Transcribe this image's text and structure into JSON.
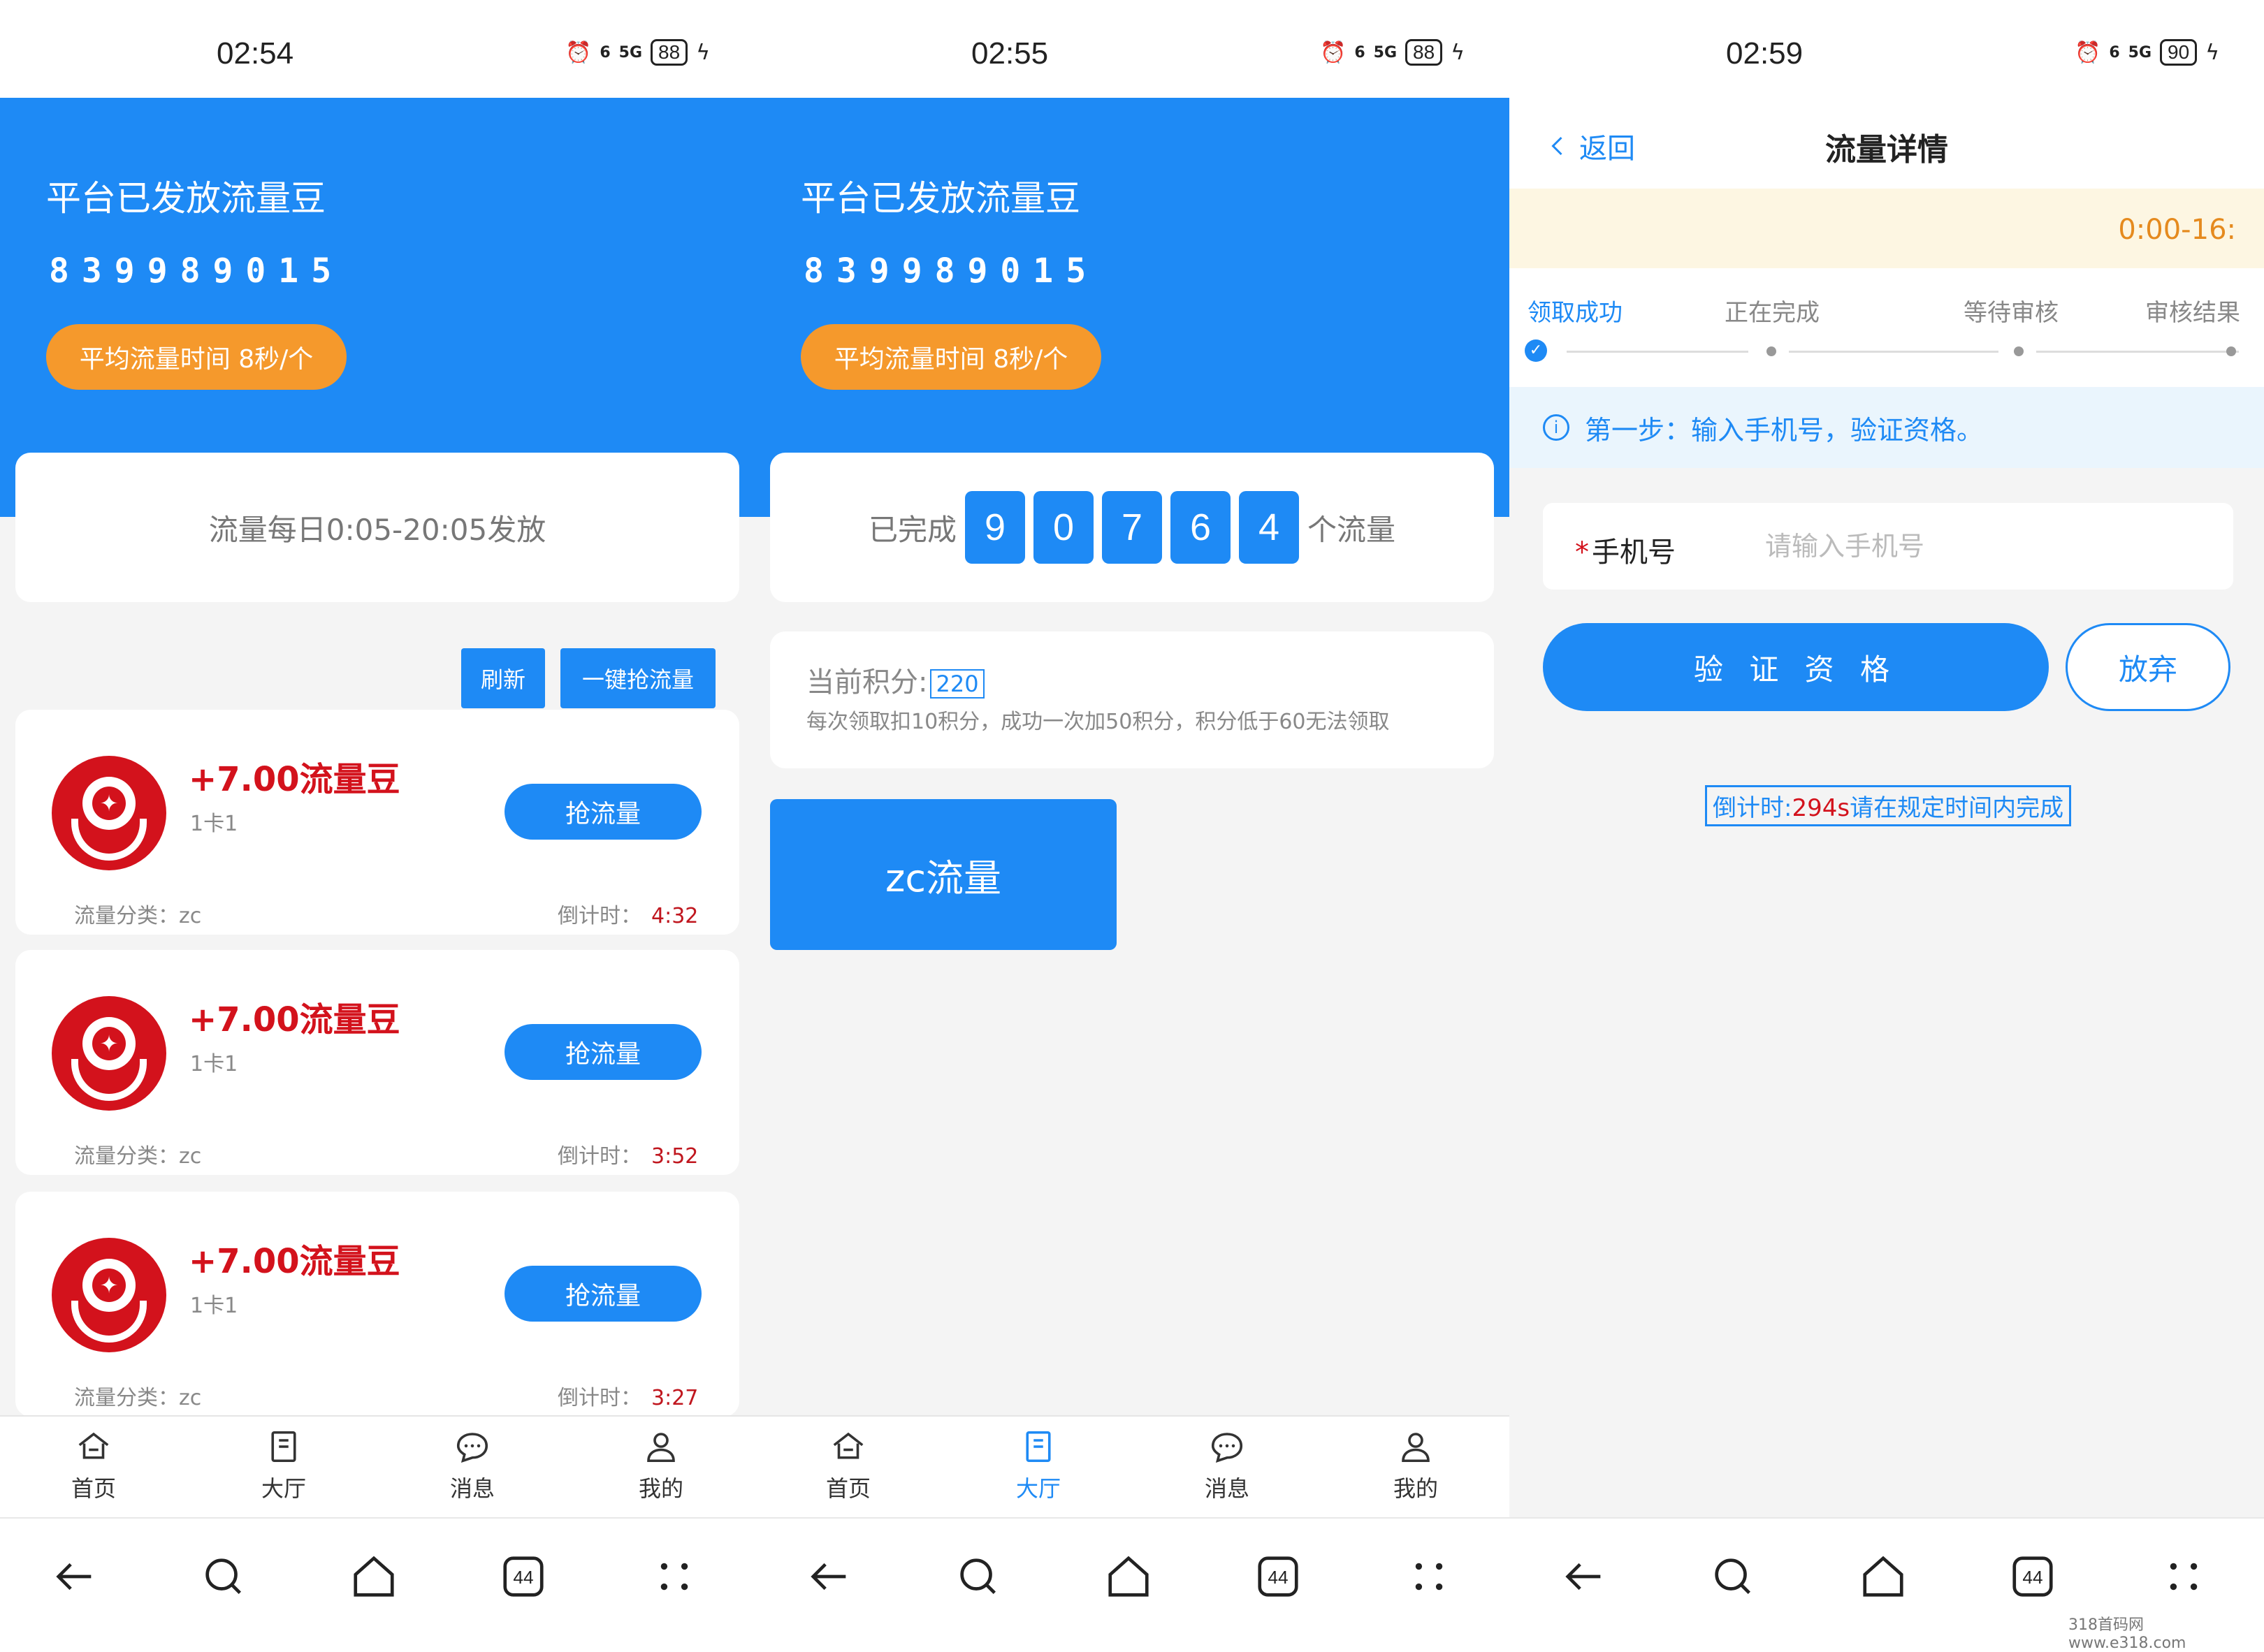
{
  "screens": [
    {
      "time": "02:54",
      "battery": "88"
    },
    {
      "time": "02:55",
      "battery": "88"
    },
    {
      "time": "02:59",
      "battery": "90"
    }
  ],
  "status_small": {
    "wifi": "6",
    "net": "5G"
  },
  "hero": {
    "title": "平台已发放流量豆",
    "number": "839989015",
    "pill": "平均流量时间 8秒/个"
  },
  "notice": "流量每日0:05-20:05发放",
  "actions": {
    "refresh": "刷新",
    "grab_all": "一键抢流量"
  },
  "items": [
    {
      "amount": "+7.00流量豆",
      "sub": "1卡1",
      "button": "抢流量",
      "category": "流量分类：zc",
      "countdown_label": "倒计时：",
      "countdown": "4:32"
    },
    {
      "amount": "+7.00流量豆",
      "sub": "1卡1",
      "button": "抢流量",
      "category": "流量分类：zc",
      "countdown_label": "倒计时：",
      "countdown": "3:52"
    },
    {
      "amount": "+7.00流量豆",
      "sub": "1卡1",
      "button": "抢流量",
      "category": "流量分类：zc",
      "countdown_label": "倒计时：",
      "countdown": "3:27"
    }
  ],
  "tabs": [
    {
      "label": "首页",
      "icon": "home-icon"
    },
    {
      "label": "大厅",
      "icon": "hall-icon"
    },
    {
      "label": "消息",
      "icon": "message-icon"
    },
    {
      "label": "我的",
      "icon": "profile-icon"
    }
  ],
  "tab_colors": {
    "active": "#1e8af5",
    "inactive": "#333333"
  },
  "navbar": {
    "recents_count": "44"
  },
  "hall": {
    "done_prefix": "已完成",
    "digits": [
      "9",
      "0",
      "7",
      "6",
      "4"
    ],
    "done_suffix": "个流量",
    "score_label": "当前积分:",
    "score_value": "220",
    "score_desc": "每次领取扣10积分，成功一次加50积分，积分低于60无法领取",
    "zc_button": "zc流量"
  },
  "detail": {
    "back": "返回",
    "title": "流量详情",
    "time_range": "0:00-16:",
    "steps": [
      "领取成功",
      "正在完成",
      "等待审核",
      "审核结果"
    ],
    "info": "第一步：输入手机号，验证资格。",
    "phone_label": "手机号",
    "phone_required": "*",
    "phone_placeholder": "请输入手机号",
    "verify_button": "验 证 资 格",
    "giveup_button": "放弃",
    "countdown_prefix": "倒计时:",
    "countdown_value": "294s",
    "countdown_suffix": "请在规定时间内完成"
  },
  "watermark": "318首码网  www.e318.com",
  "colors": {
    "brand_blue": "#1e8af5",
    "accent_orange": "#f5992c",
    "accent_red": "#d3121c"
  }
}
